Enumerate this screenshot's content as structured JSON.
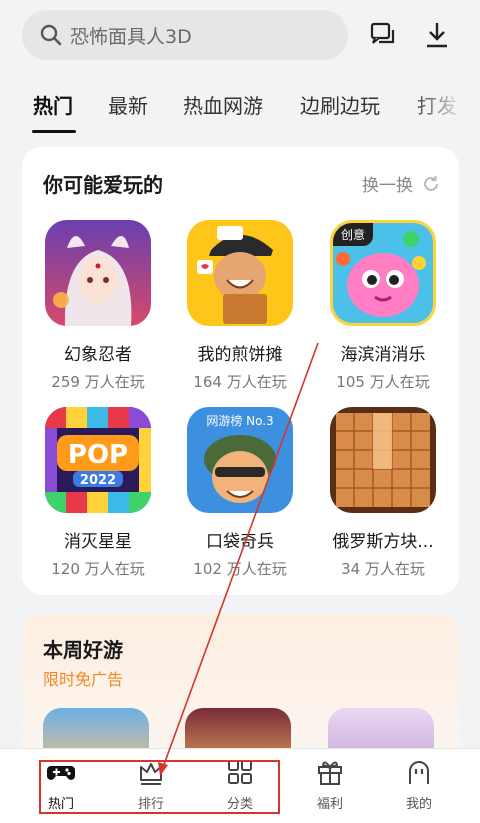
{
  "search": {
    "placeholder": "恐怖面具人3D"
  },
  "tabs": [
    "热门",
    "最新",
    "热血网游",
    "边刷边玩",
    "打发"
  ],
  "recommend": {
    "title": "你可能爱玩的",
    "refresh_label": "换一换",
    "games": [
      {
        "name": "幻象忍者",
        "players": "259 万人在玩"
      },
      {
        "name": "我的煎饼摊",
        "players": "164 万人在玩"
      },
      {
        "name": "海滨消消乐",
        "players": "105 万人在玩",
        "badge": "创意"
      },
      {
        "name": "消灭星星",
        "players": "120 万人在玩"
      },
      {
        "name": "口袋奇兵",
        "players": "102 万人在玩",
        "badge": "网游榜 No.3"
      },
      {
        "name": "俄罗斯方块...",
        "players": "34 万人在玩"
      }
    ]
  },
  "weekly": {
    "title": "本周好游",
    "subtitle": "限时免广告"
  },
  "bottom_nav": [
    {
      "label": "热门",
      "icon": "gamepad-icon"
    },
    {
      "label": "排行",
      "icon": "crown-icon"
    },
    {
      "label": "分类",
      "icon": "grid-icon"
    },
    {
      "label": "福利",
      "icon": "gift-icon"
    },
    {
      "label": "我的",
      "icon": "ghost-icon"
    }
  ],
  "colors": {
    "accent": "#f08a24",
    "annotation": "#d6352b"
  }
}
